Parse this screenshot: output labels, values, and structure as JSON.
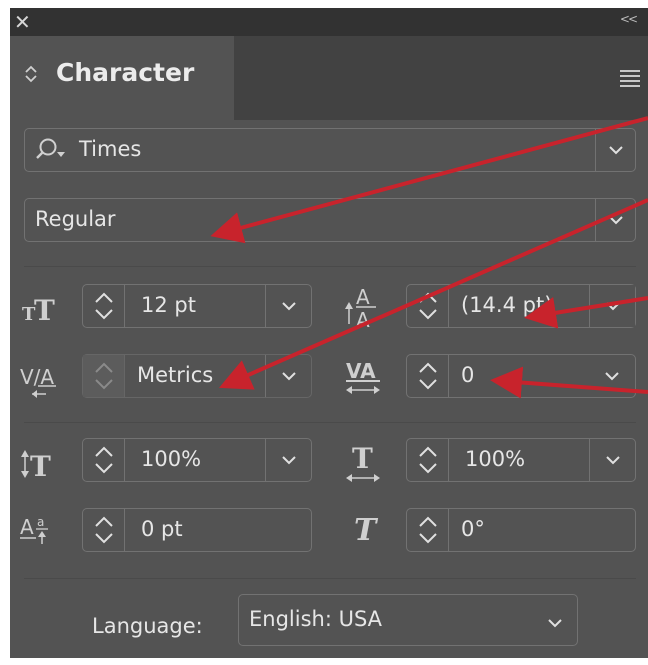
{
  "window": {
    "close_icon": "close-icon",
    "collapse_icon": "collapse-icon"
  },
  "panel": {
    "tab_label": "Character"
  },
  "font": {
    "family": "Times",
    "style": "Regular"
  },
  "size": {
    "value": "12 pt"
  },
  "leading": {
    "value": "(14.4 pt)"
  },
  "kerning": {
    "value": "Metrics"
  },
  "tracking": {
    "value": "0"
  },
  "vertical_scale": {
    "value": "100%"
  },
  "horizontal_scale": {
    "value": "100%"
  },
  "baseline_shift": {
    "value": "0 pt"
  },
  "skew": {
    "value": "0°"
  },
  "language": {
    "label": "Language:",
    "value": "English: USA"
  },
  "colors": {
    "panel_bg": "#535353",
    "field_border": "#727272",
    "annotation_arrow": "#c8232c"
  }
}
